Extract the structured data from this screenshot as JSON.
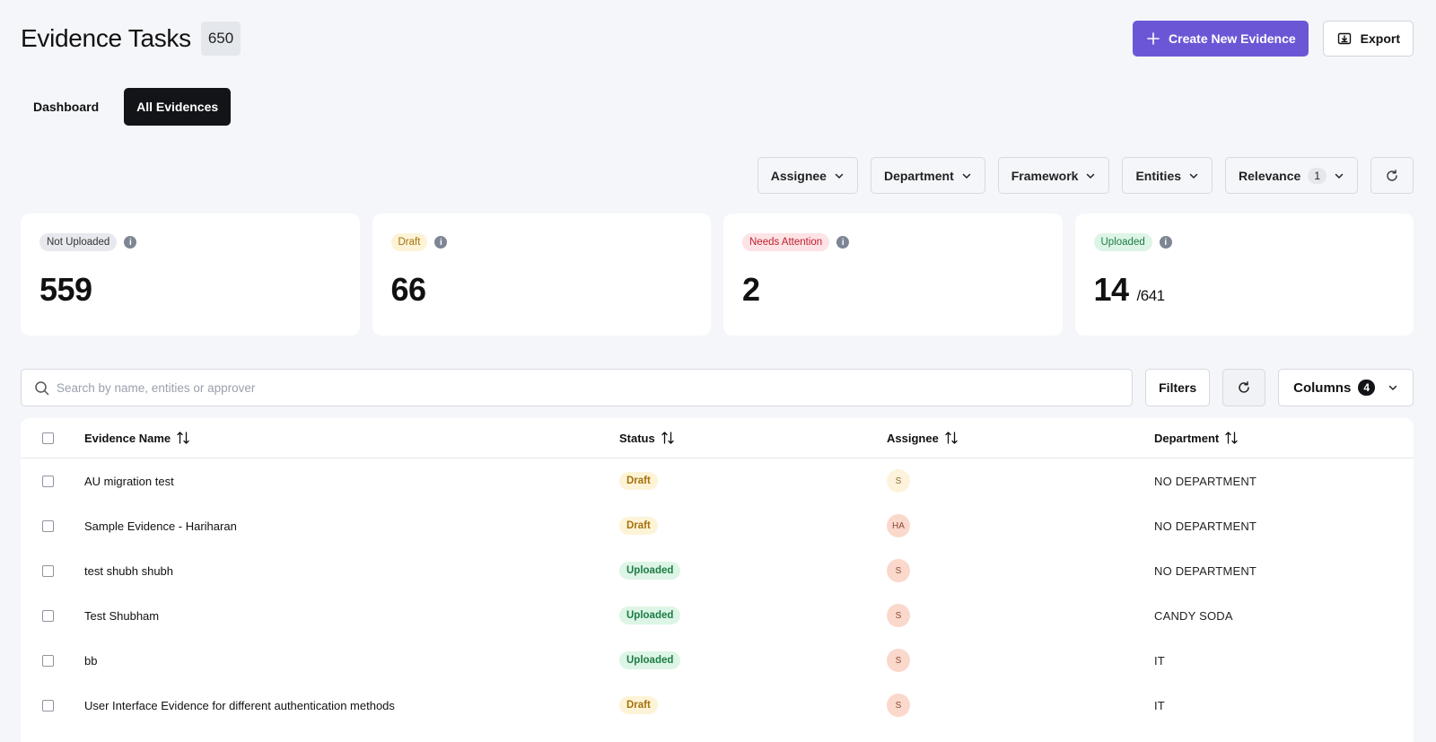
{
  "header": {
    "title": "Evidence Tasks",
    "count": "650",
    "create_label": "Create New Evidence",
    "export_label": "Export"
  },
  "tabs": [
    {
      "label": "Dashboard",
      "active": false
    },
    {
      "label": "All Evidences",
      "active": true
    }
  ],
  "filters": {
    "assignee": "Assignee",
    "department": "Department",
    "framework": "Framework",
    "entities": "Entities",
    "relevance": "Relevance",
    "relevance_count": "1"
  },
  "cards": [
    {
      "label": "Not Uploaded",
      "value": "559",
      "total": ""
    },
    {
      "label": "Draft",
      "value": "66",
      "total": ""
    },
    {
      "label": "Needs Attention",
      "value": "2",
      "total": ""
    },
    {
      "label": "Uploaded",
      "value": "14",
      "total": "/641"
    }
  ],
  "toolbar": {
    "search_placeholder": "Search by name, entities or approver",
    "filters_label": "Filters",
    "columns_label": "Columns",
    "columns_count": "4"
  },
  "table": {
    "headers": [
      "Evidence Name",
      "Status",
      "Assignee",
      "Department"
    ],
    "rows": [
      {
        "name": "AU migration test",
        "status": "Draft",
        "assignee": "S",
        "department": "NO DEPARTMENT"
      },
      {
        "name": "Sample Evidence - Hariharan",
        "status": "Draft",
        "assignee": "HA",
        "department": "NO DEPARTMENT"
      },
      {
        "name": "test shubh shubh",
        "status": "Uploaded",
        "assignee": "S",
        "department": "NO DEPARTMENT"
      },
      {
        "name": "Test Shubham",
        "status": "Uploaded",
        "assignee": "S",
        "department": "CANDY SODA"
      },
      {
        "name": "bb",
        "status": "Uploaded",
        "assignee": "S",
        "department": "IT"
      },
      {
        "name": "User Interface Evidence for different authentication methods",
        "status": "Draft",
        "assignee": "S",
        "department": "IT"
      }
    ]
  },
  "colors": {
    "accent": "#6b57d6",
    "dark": "#121418",
    "draft": "#a5720b",
    "uploaded": "#1c7c45",
    "attention": "#c0202f"
  }
}
